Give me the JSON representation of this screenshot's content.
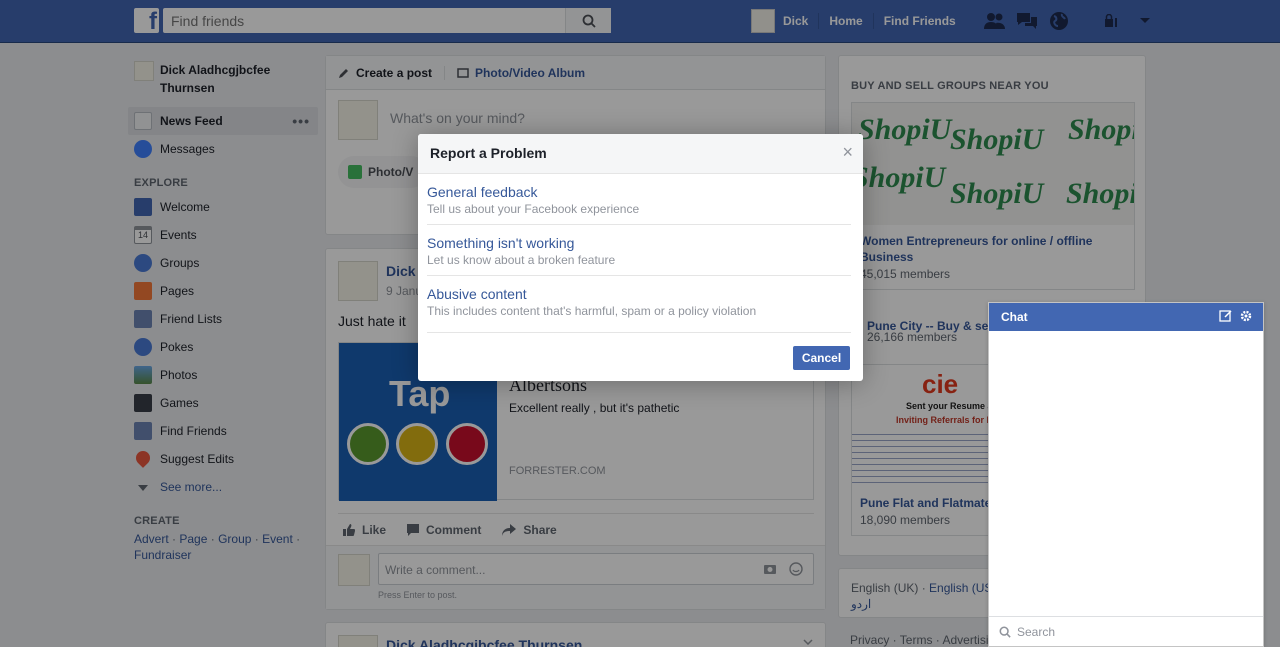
{
  "topbar": {
    "search_placeholder": "Find friends",
    "user_name": "Dick",
    "home": "Home",
    "find_friends": "Find Friends"
  },
  "left": {
    "profile_name": "Dick Aladhcgjbcfee Thurnsen",
    "nav": [
      {
        "label": "News Feed",
        "icon": "news-feed-icon"
      },
      {
        "label": "Messages",
        "icon": "messages-icon"
      }
    ],
    "explore_title": "EXPLORE",
    "explore": [
      {
        "label": "Welcome",
        "icon": "facebook-icon"
      },
      {
        "label": "Events",
        "icon": "calendar-icon"
      },
      {
        "label": "Groups",
        "icon": "groups-icon"
      },
      {
        "label": "Pages",
        "icon": "flag-icon"
      },
      {
        "label": "Friend Lists",
        "icon": "friend-list-icon"
      },
      {
        "label": "Pokes",
        "icon": "poke-icon"
      },
      {
        "label": "Photos",
        "icon": "photos-icon"
      },
      {
        "label": "Games",
        "icon": "games-icon"
      },
      {
        "label": "Find Friends",
        "icon": "find-friends-icon"
      },
      {
        "label": "Suggest Edits",
        "icon": "map-pin-icon"
      }
    ],
    "see_more": "See more...",
    "create_title": "CREATE",
    "create_links": [
      "Advert",
      "Page",
      "Group",
      "Event",
      "Fundraiser"
    ],
    "events_day": "14"
  },
  "composer": {
    "tab_create": "Create a post",
    "tab_album": "Photo/Video Album",
    "placeholder": "What's on your mind?",
    "photo_chip": "Photo/V"
  },
  "post": {
    "author": "Dick",
    "date": "9 Janu",
    "text": "Just hate it",
    "preview_image_word": "Tap",
    "preview_title": "Albertsons",
    "preview_desc": "Excellent really , but it's pathetic",
    "preview_domain": "FORRESTER.COM",
    "like": "Like",
    "comment": "Comment",
    "share": "Share",
    "comment_placeholder": "Write a comment...",
    "hint": "Press Enter to post."
  },
  "post2": {
    "author": "Dick Aladhcgjbcfee Thurnsen"
  },
  "groups": {
    "heading": "BUY AND SELL GROUPS NEAR YOU",
    "items": [
      {
        "name": "Women Entrepreneurs for online / offline Business",
        "members": "45,015 members",
        "logo_text": "ShopiU"
      },
      {
        "name": "Pune City -- Buy & sell",
        "members": "26,166 members"
      },
      {
        "name": "Pune Flat and Flatmate",
        "members": "18,090 members",
        "image_text": "Sent your Resume at h",
        "image_subtext": "Inviting Referrals for b"
      }
    ]
  },
  "language": {
    "current": "English (UK)",
    "other": "English (US",
    "urdu": "اردو"
  },
  "footer": {
    "privacy": "Privacy",
    "terms": "Terms",
    "advertising": "Advertisi"
  },
  "modal": {
    "title": "Report a Problem",
    "options": [
      {
        "title": "General feedback",
        "subtitle": "Tell us about your Facebook experience"
      },
      {
        "title": "Something isn't working",
        "subtitle": "Let us know about a broken feature"
      },
      {
        "title": "Abusive content",
        "subtitle": "This includes content that's harmful, spam or a policy violation"
      }
    ],
    "cancel": "Cancel"
  },
  "chat": {
    "title": "Chat",
    "search_placeholder": "Search"
  },
  "colors": {
    "brand": "#4267b2",
    "link": "#365899",
    "background": "#e9ebee"
  }
}
